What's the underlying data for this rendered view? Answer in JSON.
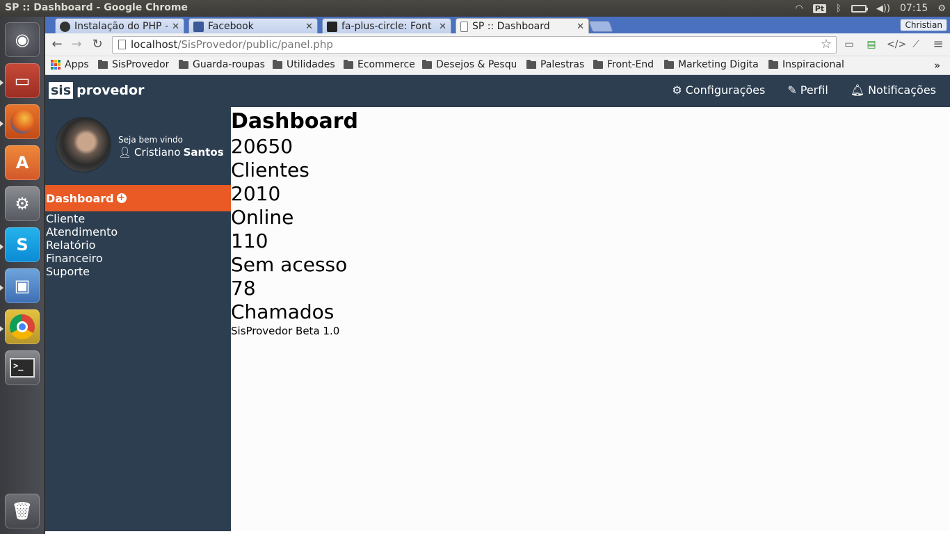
{
  "os": {
    "window_title": "SP :: Dashboard - Google Chrome",
    "tray": {
      "keyboard": "Pt",
      "time": "07:15"
    }
  },
  "browser": {
    "tabs": [
      {
        "title": "Instalação do PHP +",
        "favicon": "linux-icon",
        "active": false
      },
      {
        "title": "Facebook",
        "favicon": "facebook-icon",
        "active": false
      },
      {
        "title": "fa-plus-circle: Font A",
        "favicon": "flag-icon",
        "active": false
      },
      {
        "title": "SP :: Dashboard",
        "favicon": "page-icon",
        "active": true
      }
    ],
    "user": "Christian",
    "url_host": "localhost",
    "url_path": "/SisProvedor/public/panel.php",
    "bookmarks": [
      "Apps",
      "SisProvedor",
      "Guarda-roupas",
      "Utilidades",
      "Ecommerce",
      "Desejos & Pesqu",
      "Palestras",
      "Front-End",
      "Marketing Digita",
      "Inspiracional"
    ],
    "bookmarks_more": "»"
  },
  "site": {
    "logo_badge": "sis",
    "logo_text": "provedor",
    "nav": [
      "Configurações",
      "Perfil",
      "Notificações"
    ],
    "welcome": "Seja bem vindo",
    "user_first": "Cristiano",
    "user_last": "Santos",
    "menu_active": "Dashboard",
    "menu": [
      "Cliente",
      "Atendimento",
      "Relatório",
      "Financeiro",
      "Suporte"
    ],
    "heading": "Dashboard",
    "stats": [
      {
        "value": "20650",
        "label": "Clientes"
      },
      {
        "value": "2010",
        "label": "Online"
      },
      {
        "value": "110",
        "label": "Sem acesso"
      },
      {
        "value": "78",
        "label": "Chamados"
      }
    ],
    "footer": "SisProvedor Beta 1.0"
  }
}
